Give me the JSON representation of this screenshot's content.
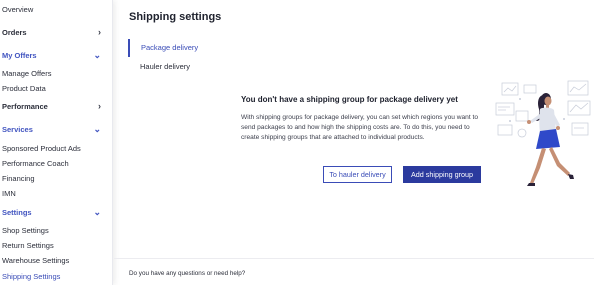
{
  "sidebar": {
    "overview": "Overview",
    "orders": "Orders",
    "my_offers": "My Offers",
    "manage_offers": "Manage Offers",
    "product_data": "Product Data",
    "performance": "Performance",
    "services": "Services",
    "sponsored_product_ads": "Sponsored Product Ads",
    "performance_coach": "Performance Coach",
    "financing": "Financing",
    "imn": "IMN",
    "settings": "Settings",
    "shop_settings": "Shop Settings",
    "return_settings": "Return Settings",
    "warehouse_settings": "Warehouse Settings",
    "shipping_settings": "Shipping Settings"
  },
  "main": {
    "title": "Shipping settings",
    "tabs": [
      "Package delivery",
      "Hauler delivery"
    ],
    "empty_title": "You don't have a shipping group for package delivery yet",
    "empty_text": "With shipping groups for package delivery, you can set which regions you want to send packages to and how high the shipping costs are. To do this, you need to create shipping groups that are attached to individual products.",
    "btn_hauler": "To hauler delivery",
    "btn_add": "Add shipping group",
    "footer": "Do you have any questions or need help?"
  },
  "colors": {
    "accent": "#3a4cb7",
    "primary_button": "#2b3a9e"
  }
}
